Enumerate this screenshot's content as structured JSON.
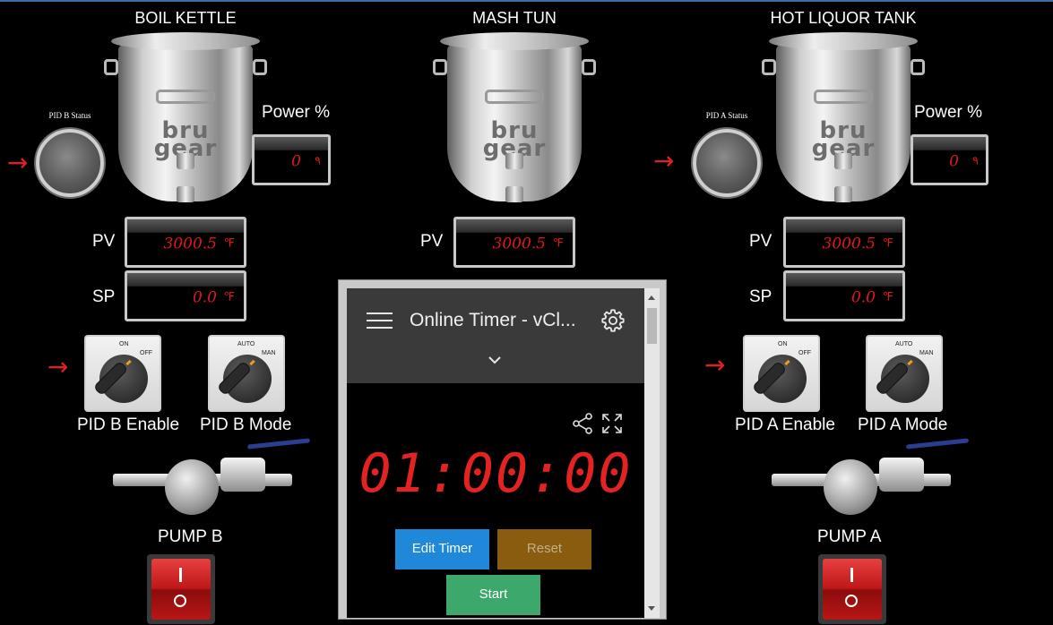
{
  "vessels": {
    "boil_kettle": {
      "title": "BOIL KETTLE",
      "logo": "bru gear"
    },
    "mash_tun": {
      "title": "MASH TUN",
      "logo": "bru gear"
    },
    "hlt": {
      "title": "HOT LIQUOR TANK",
      "logo": "bru gear"
    }
  },
  "pid_b": {
    "status_label": "PID B Status",
    "power_label": "Power %",
    "power_value": "0",
    "pv_label": "PV",
    "pv_value": "3000.5",
    "sp_label": "SP",
    "sp_value": "0.0",
    "enable_label": "PID B Enable",
    "mode_label": "PID B Mode"
  },
  "mash": {
    "pv_label": "PV",
    "pv_value": "3000.5"
  },
  "pid_a": {
    "status_label": "PID A Status",
    "power_label": "Power %",
    "power_value": "0",
    "pv_label": "PV",
    "pv_value": "3000.5",
    "sp_label": "SP",
    "sp_value": "0.0",
    "enable_label": "PID A Enable",
    "mode_label": "PID A Mode"
  },
  "units": {
    "temp": "℉"
  },
  "switch_tags": {
    "on": "ON",
    "off": "OFF",
    "auto": "AUTO",
    "man": "MAN"
  },
  "pumps": {
    "b_label": "PUMP B",
    "a_label": "PUMP A"
  },
  "timer": {
    "title": "Online Timer - vCl...",
    "time": "01:00:00",
    "edit_label": "Edit Timer",
    "reset_label": "Reset",
    "start_label": "Start"
  },
  "colors": {
    "display_red": "#e01818",
    "edit_button": "#1f88d8",
    "reset_button": "#8a5c10",
    "start_button": "#3da86b"
  }
}
